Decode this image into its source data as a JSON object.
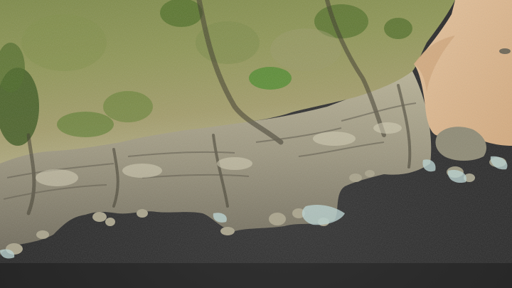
{
  "scene": {
    "background_color": "#2a2a2a",
    "palette": {
      "grass_dark": "#3f5a22",
      "grass_mid": "#6f8a3a",
      "grass_light": "#9aa55e",
      "dry_grass": "#9c9466",
      "rock_light": "#c9c2a8",
      "rock_mid": "#8f8a78",
      "rock_dark": "#4a463c",
      "sand": "#d9b48a",
      "sand_light": "#e6c39a",
      "foam": "#b9d2cf"
    }
  }
}
